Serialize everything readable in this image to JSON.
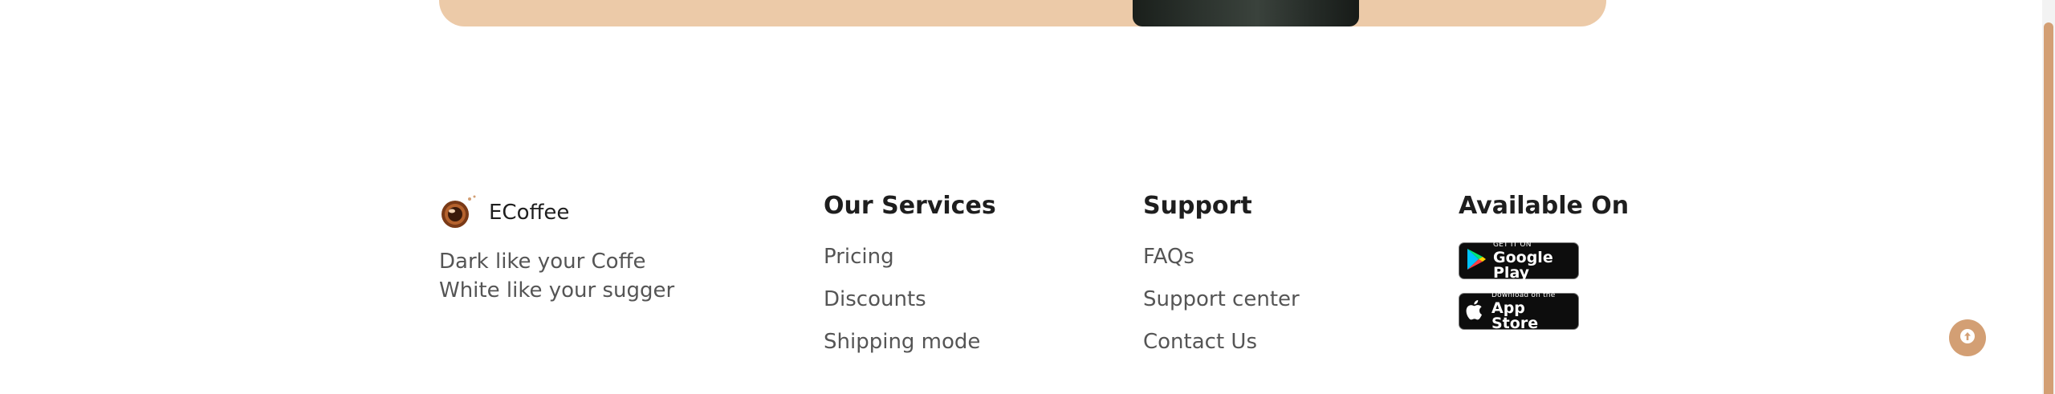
{
  "brand": {
    "name": "ECoffee",
    "tagline_line1": "Dark like your Coffe",
    "tagline_line2": "White like your sugger",
    "logo_icon": "coffee-cup-icon"
  },
  "services": {
    "title": "Our Services",
    "items": [
      "Pricing",
      "Discounts",
      "Shipping mode"
    ]
  },
  "support": {
    "title": "Support",
    "items": [
      "FAQs",
      "Support center",
      "Contact Us"
    ]
  },
  "available": {
    "title": "Available On",
    "google_play": {
      "small": "GET IT ON",
      "big": "Google Play",
      "icon": "google-play-icon"
    },
    "app_store": {
      "small": "Download on the",
      "big": "App Store",
      "icon": "apple-icon"
    }
  },
  "colors": {
    "accent": "#d39f74",
    "hero_bg": "#eccaa8",
    "text_dark": "#1e1e1e",
    "text_muted": "#555555"
  },
  "scroll_to_top_icon": "arrow-up-icon"
}
